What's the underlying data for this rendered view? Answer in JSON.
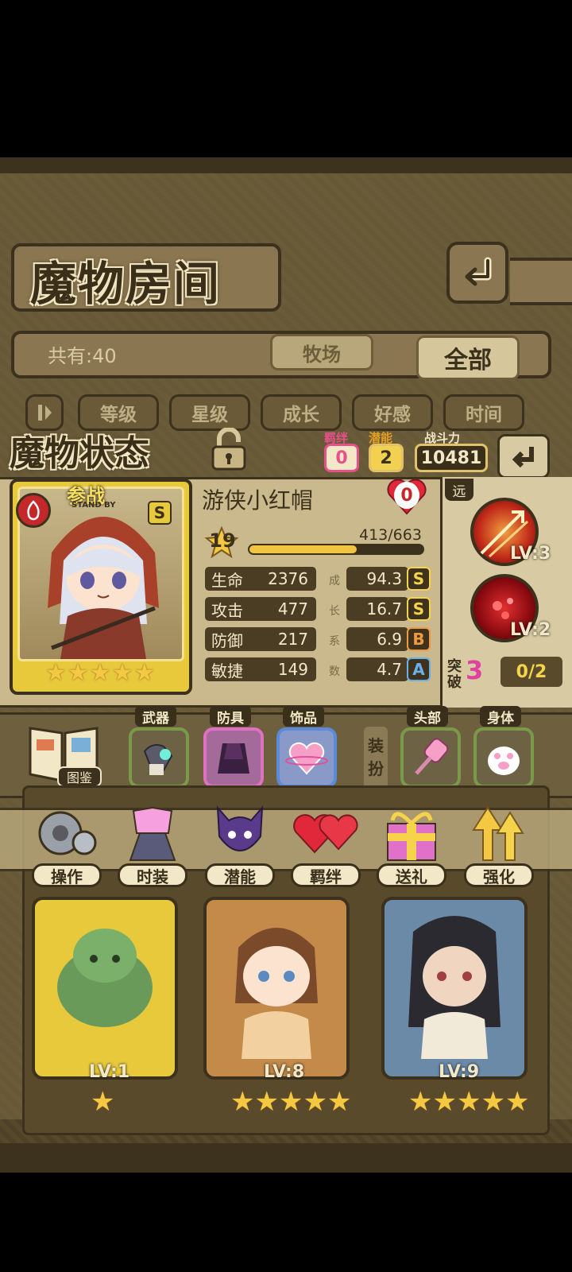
{
  "header": {
    "title": "魔物房间",
    "back_icon": "back-arrow-icon"
  },
  "filter": {
    "count_label": "共有:40",
    "tabs": [
      "牧场",
      "全部"
    ]
  },
  "sort_buttons": [
    "等级",
    "星级",
    "成长",
    "好感",
    "时间"
  ],
  "status_panel": {
    "title": "魔物状态",
    "lock_icon": "padlock-icon",
    "bond_label": "羁绊",
    "bond_value": "0",
    "potential_label": "潜能",
    "potential_value": "2",
    "power_label": "战斗力",
    "power_value": "10481"
  },
  "character": {
    "standby_label": "参战",
    "standby_sub": "STAND BY",
    "rarity": "S",
    "element_icon": "fire-icon",
    "name": "游侠小红帽",
    "affection": "0",
    "level": "19",
    "exp": "413/663",
    "exp_fraction": 0.62,
    "stars": 5,
    "stats": [
      {
        "label": "生命",
        "value": "2376",
        "growth": "94.3",
        "grade": "S"
      },
      {
        "label": "攻击",
        "value": "477",
        "growth": "16.7",
        "grade": "S"
      },
      {
        "label": "防御",
        "value": "217",
        "growth": "6.9",
        "grade": "B"
      },
      {
        "label": "敏捷",
        "value": "149",
        "growth": "4.7",
        "grade": "A"
      }
    ],
    "growth_label_chars": [
      "成",
      "长",
      "系",
      "数"
    ],
    "range_type": "远",
    "skills": [
      {
        "level": "LV:3",
        "icon": "arrow-skill-icon"
      },
      {
        "level": "LV:2",
        "icon": "blood-skill-icon"
      }
    ],
    "breakthrough_label_1": "突",
    "breakthrough_label_2": "破",
    "breakthrough_value": "3",
    "breakthrough_progress": "0/2"
  },
  "equipment": {
    "codex_label": "图鉴",
    "dress_label_1": "装",
    "dress_label_2": "扮",
    "slots": [
      {
        "label": "武器",
        "icon": "glove-icon"
      },
      {
        "label": "防具",
        "icon": "cloak-icon"
      },
      {
        "label": "饰品",
        "icon": "heart-icon"
      },
      {
        "label": "头部",
        "icon": "pink-mallet-icon"
      },
      {
        "label": "身体",
        "icon": "paw-icon"
      }
    ]
  },
  "actions": [
    "操作",
    "时装",
    "潜能",
    "羁绊",
    "送礼",
    "强化"
  ],
  "monster_cards": [
    {
      "level": "LV:1",
      "stars": 1
    },
    {
      "level": "LV:8",
      "stars": 5
    },
    {
      "level": "LV:9",
      "stars": 5
    }
  ]
}
